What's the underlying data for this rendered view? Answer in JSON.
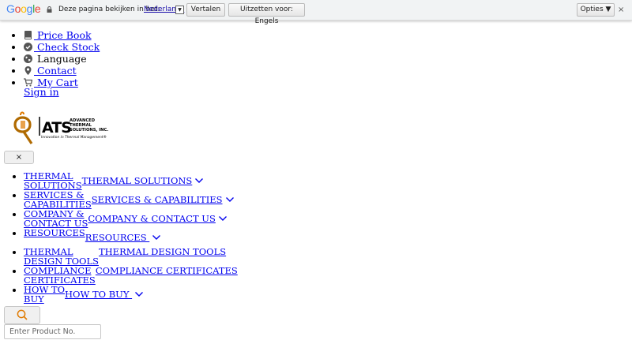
{
  "translate_bar": {
    "logo": [
      "G",
      "o",
      "o",
      "g",
      "l",
      "e"
    ],
    "prompt": "Deze pagina bekijken in het:",
    "language": "Nederlands",
    "translate_button": "Vertalen",
    "turn_off_button": "Uitzetten voor: Engels",
    "options_button": "Opties ▼",
    "close": "×"
  },
  "utility_nav": [
    {
      "label": " Price Book",
      "icon": "book-icon",
      "link": true
    },
    {
      "label": " Check Stock",
      "icon": "check-circle-icon",
      "link": true
    },
    {
      "label": " Language",
      "icon": "globe-icon",
      "link": false
    },
    {
      "label": " Contact",
      "icon": "map-pin-icon",
      "link": true
    },
    {
      "label": " My Cart",
      "icon": "cart-icon",
      "link": true
    }
  ],
  "sign_in": "Sign in",
  "logo": {
    "letters": "ATS",
    "line1": "ADVANCED",
    "line2": "THERMAL",
    "line3": "SOLUTIONS, INC.",
    "tagline": "Innovation in Thermal Management®"
  },
  "close_menu": "×",
  "main_nav": [
    {
      "line1": "THERMAL",
      "line2": "SOLUTIONS",
      "dup": "THERMAL SOLUTIONS",
      "chevron": true
    },
    {
      "line1": "SERVICES &",
      "line2": "CAPABILITIES",
      "dup": "SERVICES & CAPABILITIES",
      "chevron": true
    },
    {
      "line1": "COMPANY &",
      "line2": "CONTACT US",
      "dup": "COMPANY & CONTACT US",
      "chevron": true
    },
    {
      "line1": "RESOURCES",
      "line2": "",
      "dup": "RESOURCES ",
      "chevron": true
    },
    {
      "line1": "THERMAL",
      "line2": "DESIGN TOOLS",
      "dup": "THERMAL DESIGN TOOLS",
      "chevron": false
    },
    {
      "line1": "COMPLIANCE",
      "line2": "CERTIFICATES",
      "dup": "COMPLIANCE CERTIFICATES",
      "chevron": false
    },
    {
      "line1": "HOW TO",
      "line2": "BUY",
      "dup": "HOW TO BUY ",
      "chevron": true
    }
  ],
  "search": {
    "icon": "search-icon",
    "placeholder": "Enter Product No."
  },
  "colors": {
    "link": "#0000ee",
    "accent": "#e07a00",
    "translate_bar_bg": "#f1f3f4"
  }
}
